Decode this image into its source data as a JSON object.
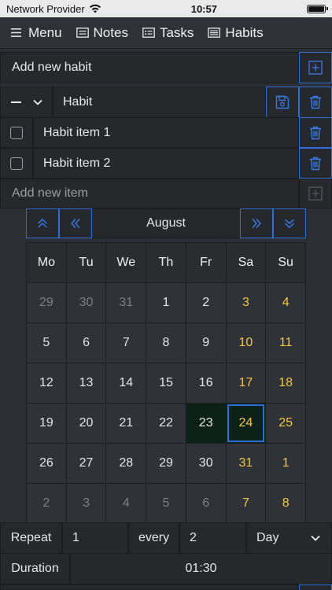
{
  "status_bar": {
    "carrier": "Network Provider",
    "time": "10:57"
  },
  "nav": {
    "items": [
      {
        "label": "Menu",
        "icon": "hamburger-icon"
      },
      {
        "label": "Notes",
        "icon": "note-icon"
      },
      {
        "label": "Tasks",
        "icon": "task-icon"
      },
      {
        "label": "Habits",
        "icon": "habit-icon"
      }
    ]
  },
  "add_habit": {
    "placeholder": "Add new habit"
  },
  "habit_editor": {
    "name": "Habit"
  },
  "items": [
    {
      "label": "Habit item 1",
      "checked": false
    },
    {
      "label": "Habit item 2",
      "checked": false
    }
  ],
  "add_item": {
    "placeholder": "Add new item"
  },
  "calendar": {
    "month": "August",
    "weekdays": [
      "Mo",
      "Tu",
      "We",
      "Th",
      "Fr",
      "Sa",
      "Su"
    ],
    "weeks": [
      [
        "29",
        "30",
        "31",
        "1",
        "2",
        "3",
        "4"
      ],
      [
        "5",
        "6",
        "7",
        "8",
        "9",
        "10",
        "11"
      ],
      [
        "12",
        "13",
        "14",
        "15",
        "16",
        "17",
        "18"
      ],
      [
        "19",
        "20",
        "21",
        "22",
        "23",
        "24",
        "25"
      ],
      [
        "26",
        "27",
        "28",
        "29",
        "30",
        "31",
        "1"
      ],
      [
        "2",
        "3",
        "4",
        "5",
        "6",
        "7",
        "8"
      ]
    ],
    "selected": "23",
    "today": "24"
  },
  "repeat": {
    "label": "Repeat",
    "count": "1",
    "every_label": "every",
    "interval": "2",
    "unit": "Day"
  },
  "duration": {
    "label": "Duration",
    "value": "01:30"
  },
  "colors": {
    "accent": "#2f6fd8",
    "weekend": "#f4c542",
    "background": "#2b2e33"
  }
}
